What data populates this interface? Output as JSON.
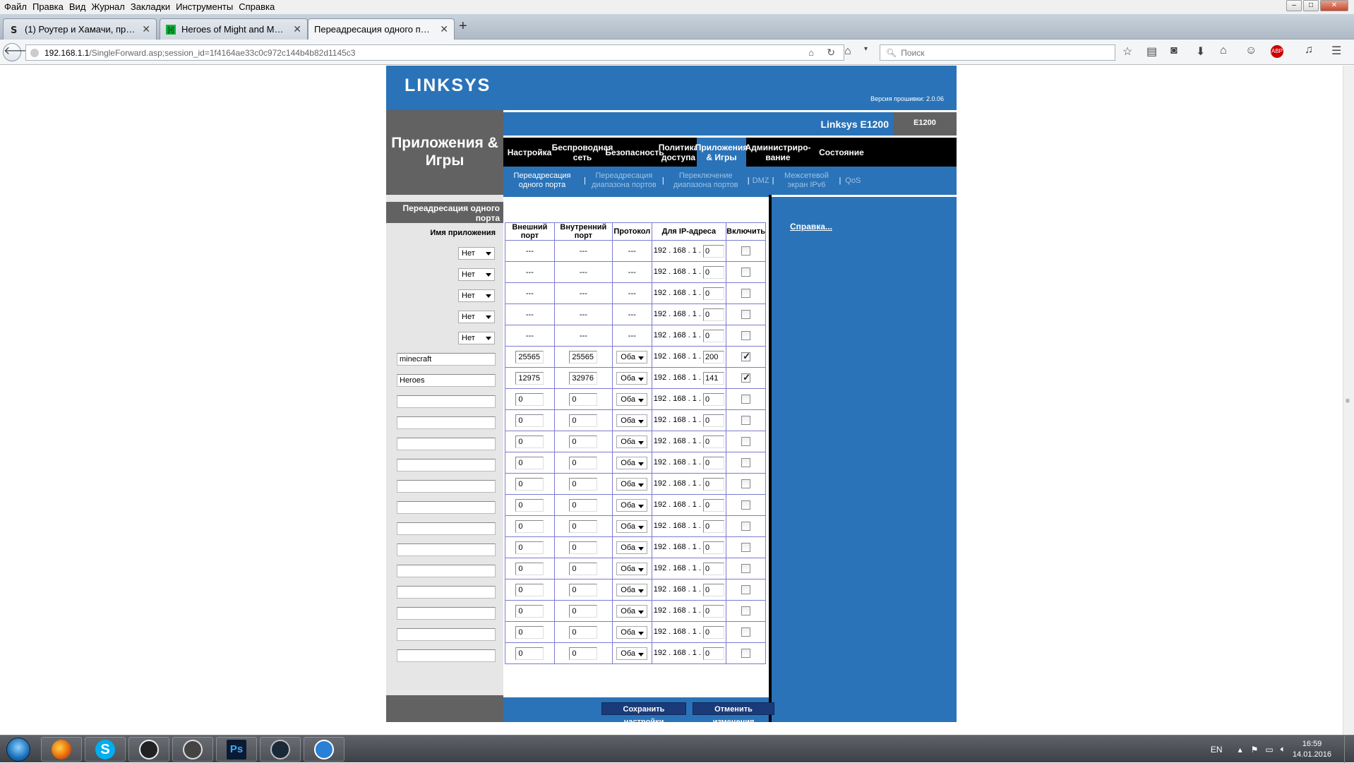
{
  "menubar": [
    "Файл",
    "Правка",
    "Вид",
    "Журнал",
    "Закладки",
    "Инструменты",
    "Справка"
  ],
  "window_controls": [
    "–",
    "□",
    "✕"
  ],
  "tabs": [
    {
      "label": "(1) Роутер и Хамачи, про...",
      "icon": "steam-favicon",
      "active": false
    },
    {
      "label": "Heroes of Might and Magi...",
      "icon": "heroes-favicon",
      "active": false
    },
    {
      "label": "Переадресация одного порта",
      "icon": "none",
      "active": true
    }
  ],
  "new_tab": "+",
  "url": {
    "host": "192.168.1.1",
    "path": "/SingleForward.asp;session_id=1f4164ae33c0c972c144b4b82d1145c3"
  },
  "search": {
    "placeholder": "Поиск"
  },
  "router": {
    "logo": "LINKSYS",
    "firmware": "Версия прошивки: 2.0.06",
    "section_title": "Приложения & Игры",
    "model_name": "Linksys E1200",
    "model_id": "E1200",
    "main_nav": [
      "Настройка",
      "Беспроводная сеть",
      "Безопасность",
      "Политика доступа",
      "Приложения & Игры",
      "Администриро-вание",
      "Состояние"
    ],
    "main_nav_active": 4,
    "sub_nav": [
      "Переадресация одного порта",
      "Переадресация диапазона портов",
      "Переключение диапазона портов",
      "DMZ",
      "Межсетевой экран IPv6",
      "QoS"
    ],
    "sub_nav_active": 0,
    "left_title": "Переадресация одного порта",
    "app_name_label": "Имя приложения",
    "headers": [
      "Внешний порт",
      "Внутренний порт",
      "Протокол",
      "Для IP-адреса",
      "Включить"
    ],
    "ip_prefix": "192 . 168 . 1 .",
    "rows": [
      {
        "app": "Нет",
        "app_type": "select",
        "ext": "---",
        "int": "---",
        "proto": "---",
        "ip": "0",
        "on": false
      },
      {
        "app": "Нет",
        "app_type": "select",
        "ext": "---",
        "int": "---",
        "proto": "---",
        "ip": "0",
        "on": false
      },
      {
        "app": "Нет",
        "app_type": "select",
        "ext": "---",
        "int": "---",
        "proto": "---",
        "ip": "0",
        "on": false
      },
      {
        "app": "Нет",
        "app_type": "select",
        "ext": "---",
        "int": "---",
        "proto": "---",
        "ip": "0",
        "on": false
      },
      {
        "app": "Нет",
        "app_type": "select",
        "ext": "---",
        "int": "---",
        "proto": "---",
        "ip": "0",
        "on": false
      },
      {
        "app": "minecraft",
        "app_type": "text",
        "ext": "25565",
        "int": "25565",
        "proto": "Оба",
        "ip": "200",
        "on": true
      },
      {
        "app": "Heroes",
        "app_type": "text",
        "ext": "12975",
        "int": "32976",
        "proto": "Оба",
        "ip": "141",
        "on": true
      },
      {
        "app": "",
        "app_type": "text",
        "ext": "0",
        "int": "0",
        "proto": "Оба",
        "ip": "0",
        "on": false
      },
      {
        "app": "",
        "app_type": "text",
        "ext": "0",
        "int": "0",
        "proto": "Оба",
        "ip": "0",
        "on": false
      },
      {
        "app": "",
        "app_type": "text",
        "ext": "0",
        "int": "0",
        "proto": "Оба",
        "ip": "0",
        "on": false
      },
      {
        "app": "",
        "app_type": "text",
        "ext": "0",
        "int": "0",
        "proto": "Оба",
        "ip": "0",
        "on": false
      },
      {
        "app": "",
        "app_type": "text",
        "ext": "0",
        "int": "0",
        "proto": "Оба",
        "ip": "0",
        "on": false
      },
      {
        "app": "",
        "app_type": "text",
        "ext": "0",
        "int": "0",
        "proto": "Оба",
        "ip": "0",
        "on": false
      },
      {
        "app": "",
        "app_type": "text",
        "ext": "0",
        "int": "0",
        "proto": "Оба",
        "ip": "0",
        "on": false
      },
      {
        "app": "",
        "app_type": "text",
        "ext": "0",
        "int": "0",
        "proto": "Оба",
        "ip": "0",
        "on": false
      },
      {
        "app": "",
        "app_type": "text",
        "ext": "0",
        "int": "0",
        "proto": "Оба",
        "ip": "0",
        "on": false
      },
      {
        "app": "",
        "app_type": "text",
        "ext": "0",
        "int": "0",
        "proto": "Оба",
        "ip": "0",
        "on": false
      },
      {
        "app": "",
        "app_type": "text",
        "ext": "0",
        "int": "0",
        "proto": "Оба",
        "ip": "0",
        "on": false
      },
      {
        "app": "",
        "app_type": "text",
        "ext": "0",
        "int": "0",
        "proto": "Оба",
        "ip": "0",
        "on": false
      },
      {
        "app": "",
        "app_type": "text",
        "ext": "0",
        "int": "0",
        "proto": "Оба",
        "ip": "0",
        "on": false
      }
    ],
    "save_label": "Сохранить настройки",
    "cancel_label": "Отменить изменения",
    "help_label": "Справка..."
  },
  "taskbar": {
    "apps": [
      "firefox-icon",
      "skype-icon",
      "obs-icon",
      "inkscape-icon",
      "photoshop-icon",
      "steam-icon",
      "hamachi-icon"
    ],
    "photoshop_label": "Ps",
    "lang": "EN",
    "time": "16:59",
    "date": "14.01.2016"
  },
  "colors": {
    "linksys_blue": "#2a73b8",
    "linksys_gray": "#626262",
    "table_border": "#7b7bd0"
  }
}
